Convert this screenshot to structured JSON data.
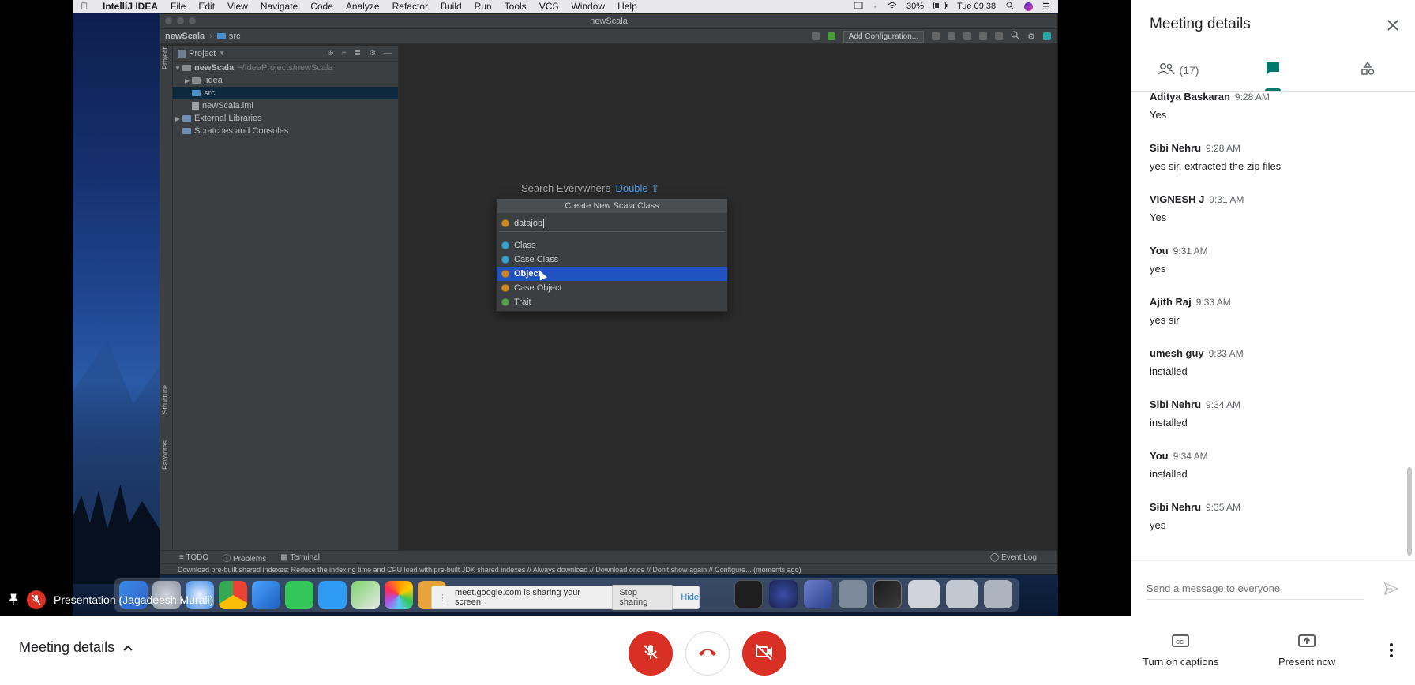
{
  "mac": {
    "app_name": "IntelliJ IDEA",
    "menus": [
      "File",
      "Edit",
      "View",
      "Navigate",
      "Code",
      "Analyze",
      "Refactor",
      "Build",
      "Run",
      "Tools",
      "VCS",
      "Window",
      "Help"
    ],
    "battery": "30%",
    "clock": "Tue 09:38"
  },
  "ide": {
    "window_title": "newScala",
    "breadcrumb_project": "newScala",
    "breadcrumb_folder": "src",
    "add_config": "Add Configuration...",
    "project_panel_title": "Project",
    "tree": {
      "root_name": "newScala",
      "root_path": "~/IdeaProjects/newScala",
      "idea": ".idea",
      "src": "src",
      "iml": "newScala.iml",
      "ext_libs": "External Libraries",
      "scratches": "Scratches and Consoles"
    },
    "side_tabs": {
      "project": "Project",
      "structure": "Structure",
      "favorites": "Favorites"
    },
    "search_hint": "Search Everywhere",
    "search_hint_key": "Double ⇧",
    "popup": {
      "title": "Create New Scala Class",
      "input_value": "datajob",
      "items": [
        "Class",
        "Case Class",
        "Object",
        "Case Object",
        "Trait"
      ],
      "selected": "Object"
    },
    "tool_tabs": [
      "TODO",
      "Problems",
      "Terminal"
    ],
    "event_log": "Event Log",
    "status_text": "Download pre-built shared indexes: Reduce the indexing time and CPU load with pre-built JDK shared indexes // Always download // Download once // Don't show again // Configure... (moments ago)"
  },
  "share_bar": {
    "text": "meet.google.com is sharing your screen.",
    "stop": "Stop sharing",
    "hide": "Hide"
  },
  "presentation_label": "Presentation (Jagadeesh Murali)",
  "panel": {
    "title": "Meeting details",
    "people_count": "(17)",
    "messages": [
      {
        "sender": "Aditya Baskaran",
        "time": "9:28 AM",
        "text": "Yes"
      },
      {
        "sender": "Sibi Nehru",
        "time": "9:28 AM",
        "text": "yes sir, extracted the zip files"
      },
      {
        "sender": "VIGNESH J",
        "time": "9:31 AM",
        "text": "Yes"
      },
      {
        "sender": "You",
        "time": "9:31 AM",
        "text": "yes"
      },
      {
        "sender": "Ajith Raj",
        "time": "9:33 AM",
        "text": "yes sir"
      },
      {
        "sender": "umesh guy",
        "time": "9:33 AM",
        "text": "installed"
      },
      {
        "sender": "Sibi Nehru",
        "time": "9:34 AM",
        "text": "installed"
      },
      {
        "sender": "You",
        "time": "9:34 AM",
        "text": "installed"
      },
      {
        "sender": "Sibi Nehru",
        "time": "9:35 AM",
        "text": "yes"
      }
    ],
    "input_placeholder": "Send a message to everyone"
  },
  "bottom": {
    "meeting_details": "Meeting details",
    "captions": "Turn on captions",
    "present": "Present now"
  },
  "colors": {
    "accent_teal": "#00796b",
    "danger_red": "#d93025",
    "ide_selection": "#2052c2"
  }
}
